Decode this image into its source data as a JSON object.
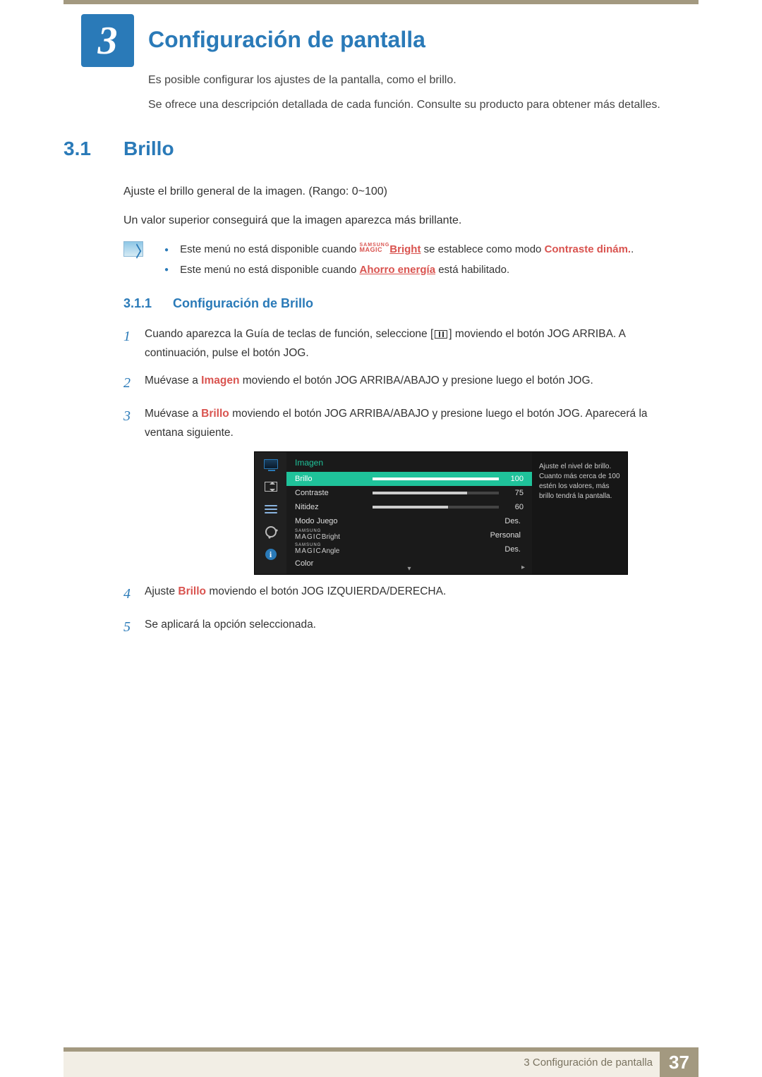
{
  "chapter": {
    "number": "3",
    "title": "Configuración de pantalla",
    "intro1": "Es posible configurar los ajustes de la pantalla, como el brillo.",
    "intro2": "Se ofrece una descripción detallada de cada función. Consulte su producto para obtener más detalles."
  },
  "section": {
    "num": "3.1",
    "title": "Brillo",
    "p1": "Ajuste el brillo general de la imagen. (Rango: 0~100)",
    "p2": "Un valor superior conseguirá que la imagen aparezca más brillante."
  },
  "notes": {
    "item1_a": "Este menú no está disponible cuando ",
    "item1_brand_top": "SAMSUNG",
    "item1_brand_bot": "MAGIC",
    "item1_b": "Bright",
    "item1_c": " se establece como modo ",
    "item1_d": "Contraste dinám.",
    "item1_e": ".",
    "item2_a": "Este menú no está disponible cuando ",
    "item2_b": "Ahorro energía",
    "item2_c": " está habilitado."
  },
  "subsection": {
    "num": "3.1.1",
    "title": "Configuración de Brillo"
  },
  "steps": {
    "s1_a": "Cuando aparezca la Guía de teclas de función, seleccione [",
    "s1_b": "] moviendo el botón JOG ARRIBA. A continuación, pulse el botón JOG.",
    "s2_a": "Muévase a ",
    "s2_b": "Imagen",
    "s2_c": " moviendo el botón JOG ARRIBA/ABAJO y presione luego el botón JOG.",
    "s3_a": "Muévase a ",
    "s3_b": "Brillo",
    "s3_c": " moviendo el botón JOG ARRIBA/ABAJO y presione luego el botón JOG. Aparecerá la ventana siguiente.",
    "s4_a": "Ajuste ",
    "s4_b": "Brillo",
    "s4_c": " moviendo el botón JOG IZQUIERDA/DERECHA.",
    "s5": "Se aplicará la opción seleccionada."
  },
  "osd": {
    "header": "Imagen",
    "help": "Ajuste el nivel de brillo. Cuanto más cerca de 100 estén los valores, más brillo tendrá la pantalla.",
    "rows": {
      "brillo": {
        "label": "Brillo",
        "value": "100",
        "fill": 100
      },
      "contraste": {
        "label": "Contraste",
        "value": "75",
        "fill": 75
      },
      "nitidez": {
        "label": "Nitidez",
        "value": "60",
        "fill": 60
      },
      "modojuego": {
        "label": "Modo Juego",
        "value": "Des."
      },
      "magicbright": {
        "brand_top": "SAMSUNG",
        "brand_bot": "MAGIC",
        "suffix": "Bright",
        "value": "Personal"
      },
      "magicangle": {
        "brand_top": "SAMSUNG",
        "brand_bot": "MAGIC",
        "suffix": "Angle",
        "value": "Des."
      },
      "color": {
        "label": "Color"
      }
    },
    "nav_down": "▾",
    "nav_right": "▸"
  },
  "footer": {
    "title": "3 Configuración de pantalla",
    "page": "37"
  },
  "step_numbers": {
    "n1": "1",
    "n2": "2",
    "n3": "3",
    "n4": "4",
    "n5": "5"
  }
}
